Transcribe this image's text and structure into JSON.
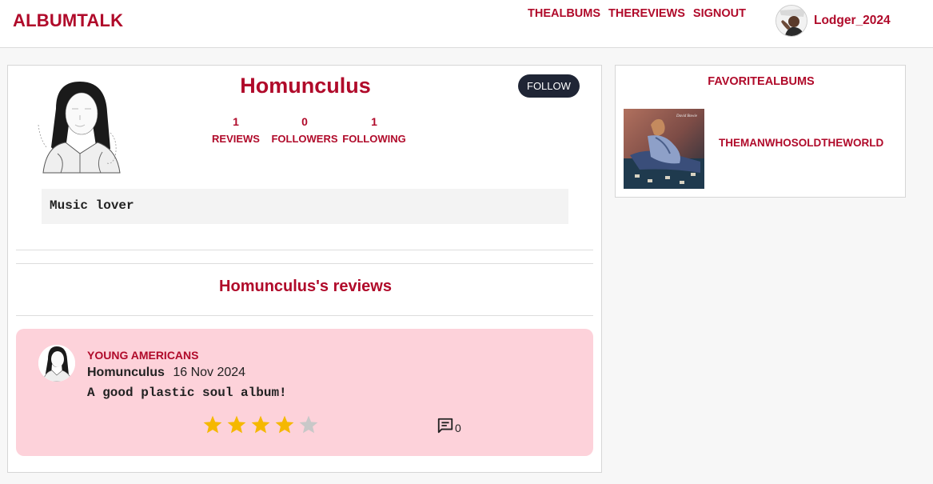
{
  "header": {
    "brand": "ALBUMTALK",
    "nav": [
      "THEALBUMS",
      "THEREVIEWS",
      "SIGNOUT"
    ],
    "username": "Lodger_2024"
  },
  "profile": {
    "username": "Homunculus",
    "follow_label": "FOLLOW",
    "stats": [
      {
        "value": "1",
        "label": "REVIEWS"
      },
      {
        "value": "0",
        "label": "FOLLOWERS"
      },
      {
        "value": "1",
        "label": "FOLLOWING"
      }
    ],
    "bio": "Music lover",
    "reviews_heading": "Homunculus's reviews"
  },
  "reviews": [
    {
      "album": "YOUNG AMERICANS",
      "author": "Homunculus",
      "date": "16 Nov 2024",
      "text": "A good plastic soul album!",
      "rating": 4,
      "max_rating": 5,
      "comments": "0"
    }
  ],
  "favorites": {
    "title": "FAVORITEALBUMS",
    "items": [
      {
        "title": "THEMANWHOSOLDTHEWORLD"
      }
    ]
  },
  "colors": {
    "accent": "#b00a2a",
    "review_bg": "#fdd2da",
    "star_filled": "#f5b800",
    "star_empty": "#c8c8c8",
    "follow_button": "#1f2535"
  }
}
